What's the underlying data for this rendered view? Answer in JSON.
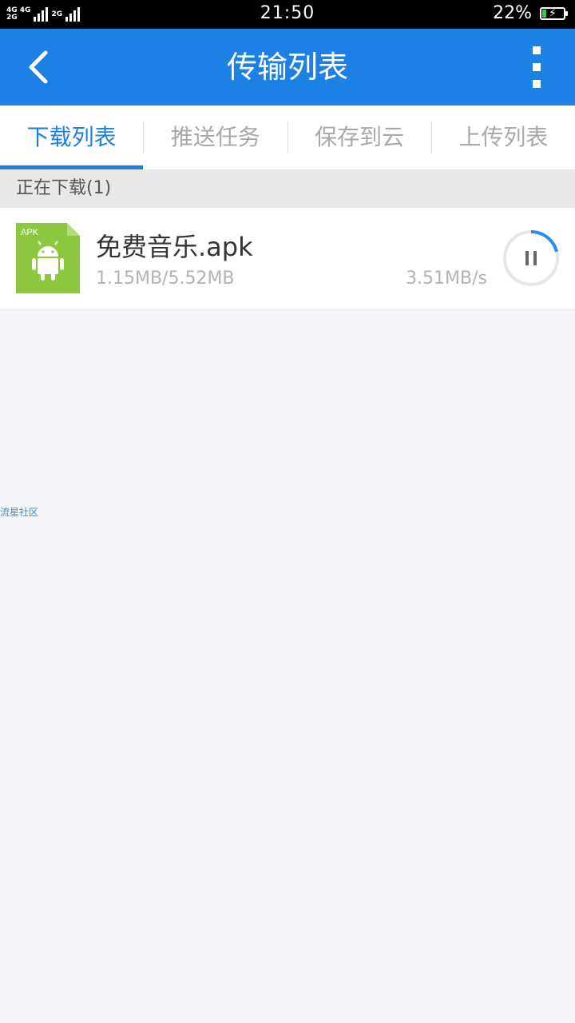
{
  "status_bar": {
    "net_top": "4G 4G",
    "net_bottom": "2G",
    "net_right": "2G",
    "time": "21:50",
    "battery_percent": "22%",
    "battery_level": 0.22,
    "battery_color": "#2ecc40"
  },
  "header": {
    "title": "传输列表",
    "back_icon": "chevron-left-icon",
    "menu_icon": "more-vertical-icon",
    "color": "#1d80e4"
  },
  "tabs": [
    {
      "label": "下载列表",
      "active": true
    },
    {
      "label": "推送任务",
      "active": false
    },
    {
      "label": "保存到云",
      "active": false
    },
    {
      "label": "上传列表",
      "active": false
    }
  ],
  "section": {
    "title": "正在下载(1)"
  },
  "download": {
    "icon_label": "APK",
    "icon_color": "#8dc63f",
    "name": "免费音乐.apk",
    "size": "1.15MB/5.52MB",
    "speed": "3.51MB/s",
    "progress": 0.21,
    "action_icon": "pause-icon"
  },
  "watermark": "流星社区"
}
